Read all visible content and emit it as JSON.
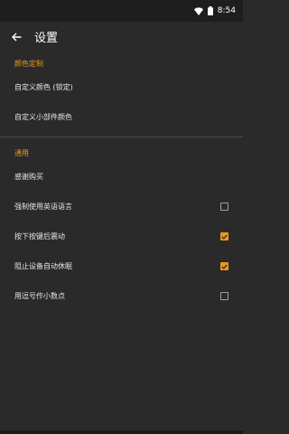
{
  "status_bar": {
    "time": "8:54",
    "icons": [
      "wifi-icon",
      "battery-icon"
    ]
  },
  "toolbar": {
    "title": "设置",
    "back_icon": "arrow-back-icon"
  },
  "sections": {
    "colors": {
      "header": "颜色定制",
      "items": [
        {
          "label": "自定义颜色 (锁定)"
        },
        {
          "label": "自定义小部件颜色"
        }
      ]
    },
    "general": {
      "header": "通用",
      "items": [
        {
          "label": "感谢购买"
        },
        {
          "label": "强制使用英语语言",
          "checked": false
        },
        {
          "label": "按下按键后震动",
          "checked": true
        },
        {
          "label": "阻止设备自动休眠",
          "checked": true
        },
        {
          "label": "用逗号作小数点",
          "checked": false
        }
      ]
    }
  },
  "colors": {
    "accent": "#f0961e",
    "background": "#2a2a2a"
  }
}
